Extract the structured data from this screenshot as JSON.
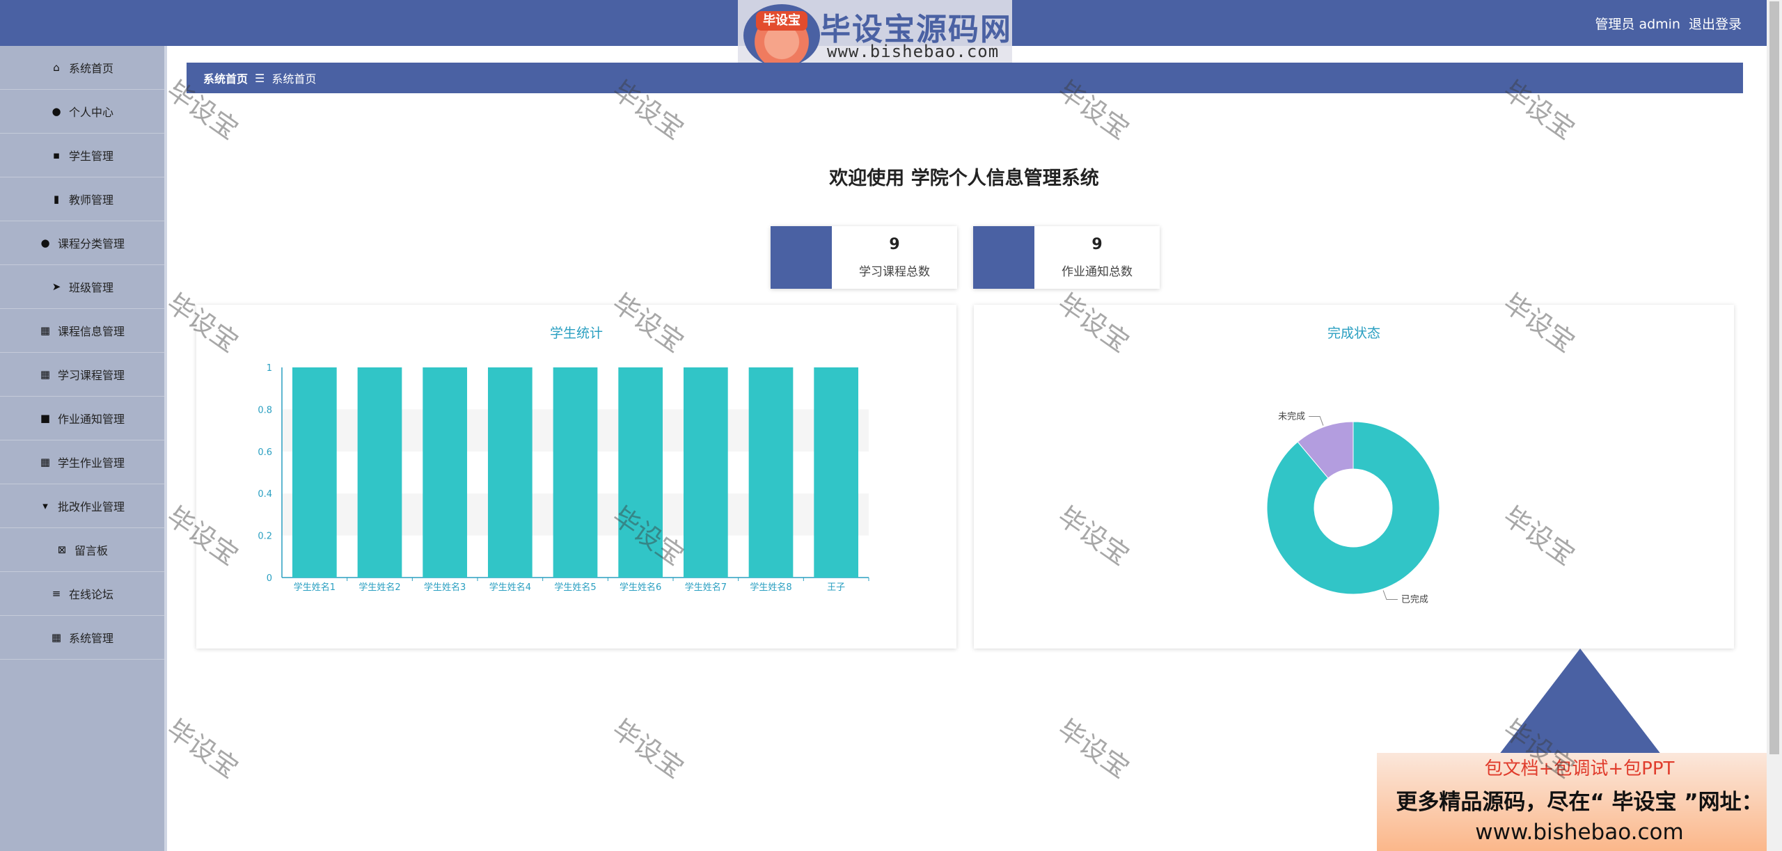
{
  "header": {
    "user_role": "管理员 admin",
    "logout": "退出登录"
  },
  "logo": {
    "badge": "毕设宝",
    "title": "毕设宝源码网",
    "url": "www.bishebao.com"
  },
  "sidebar": {
    "items": [
      {
        "label": "系统首页",
        "icon": "home-icon"
      },
      {
        "label": "个人中心",
        "icon": "user-icon"
      },
      {
        "label": "学生管理",
        "icon": "chat-icon"
      },
      {
        "label": "教师管理",
        "icon": "book-icon"
      },
      {
        "label": "课程分类管理",
        "icon": "user-icon"
      },
      {
        "label": "班级管理",
        "icon": "send-icon"
      },
      {
        "label": "课程信息管理",
        "icon": "grid-icon"
      },
      {
        "label": "学习课程管理",
        "icon": "apps-icon"
      },
      {
        "label": "作业通知管理",
        "icon": "video-icon"
      },
      {
        "label": "学生作业管理",
        "icon": "grid-icon"
      },
      {
        "label": "批改作业管理",
        "icon": "flag-icon"
      },
      {
        "label": "留言板",
        "icon": "close-box-icon"
      },
      {
        "label": "在线论坛",
        "icon": "menu-icon"
      },
      {
        "label": "系统管理",
        "icon": "grid-icon"
      }
    ]
  },
  "breadcrumb": {
    "root": "系统首页",
    "separator": "☰",
    "current": "系统首页"
  },
  "welcome": "欢迎使用 学院个人信息管理系统",
  "stats": [
    {
      "value": "9",
      "label": "学习课程总数"
    },
    {
      "value": "9",
      "label": "作业通知总数"
    }
  ],
  "colors": {
    "primary": "#4a61a3",
    "bar": "#31c5c7",
    "pie_done": "#31c5c7",
    "pie_undone": "#b39ddf",
    "chart_title": "#2a9fc1"
  },
  "chart_data": [
    {
      "type": "bar",
      "title": "学生统计",
      "categories": [
        "学生姓名1",
        "学生姓名2",
        "学生姓名3",
        "学生姓名4",
        "学生姓名5",
        "学生姓名6",
        "学生姓名7",
        "学生姓名8",
        "王子"
      ],
      "values": [
        1,
        1,
        1,
        1,
        1,
        1,
        1,
        1,
        1
      ],
      "yticks": [
        "0",
        "0.2",
        "0.4",
        "0.6",
        "0.8",
        "1"
      ],
      "ylim": [
        0,
        1
      ]
    },
    {
      "type": "pie",
      "title": "完成状态",
      "labels": [
        "已完成",
        "未完成"
      ],
      "values": [
        8,
        1
      ]
    }
  ],
  "watermark": "毕设宝",
  "promo": {
    "line1": "包文档+包调试+包PPT",
    "line2": "更多精品源码，尽在“ 毕设宝 ”网址：",
    "line3": "www.bishebao.com"
  }
}
